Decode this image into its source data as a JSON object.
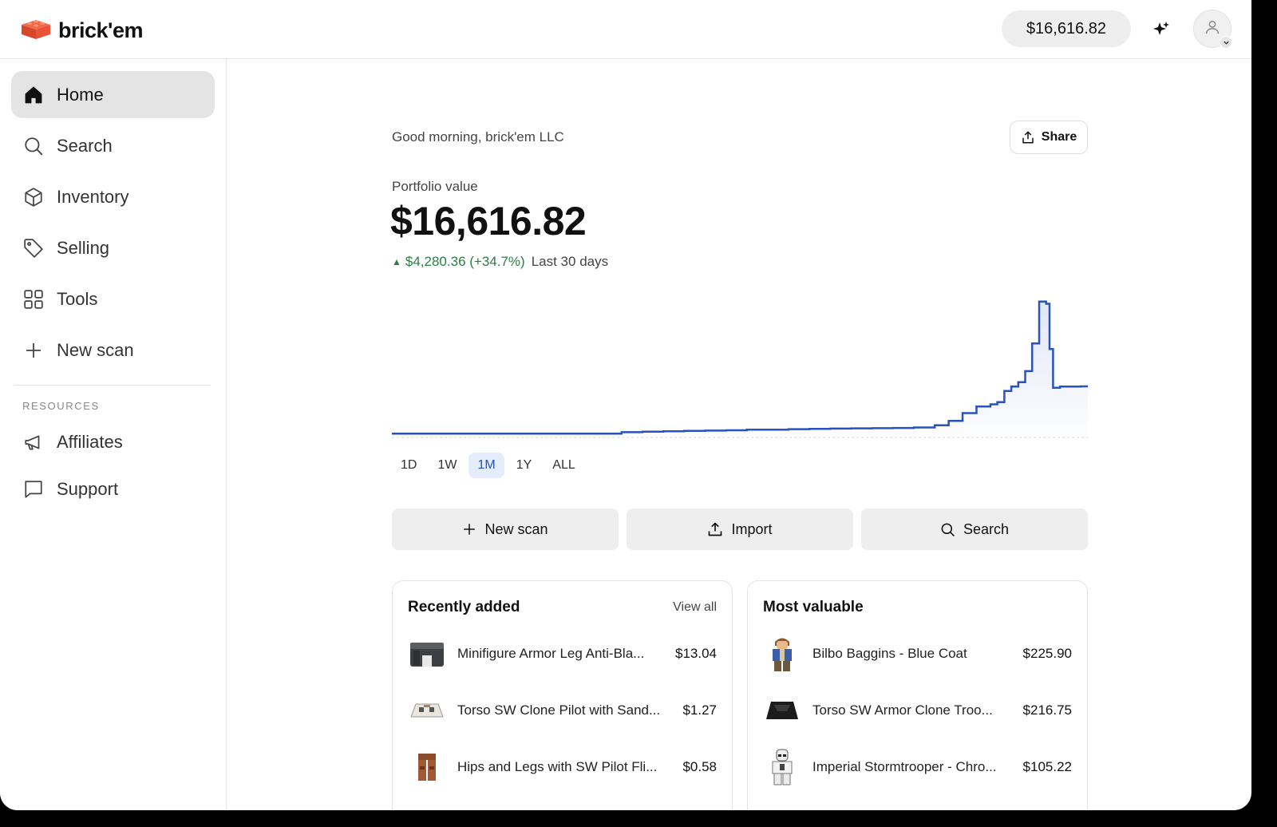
{
  "header": {
    "brand": "brick'em",
    "balance": "$16,616.82",
    "sparkle_icon": "sparkles-icon",
    "avatar_icon": "user-icon"
  },
  "sidebar": {
    "items": [
      {
        "label": "Home",
        "icon": "home-icon",
        "active": true
      },
      {
        "label": "Search",
        "icon": "search-icon"
      },
      {
        "label": "Inventory",
        "icon": "box-icon"
      },
      {
        "label": "Selling",
        "icon": "tag-icon"
      },
      {
        "label": "Tools",
        "icon": "grid-icon"
      },
      {
        "label": "New scan",
        "icon": "plus-icon"
      }
    ],
    "resources_title": "RESOURCES",
    "resources": [
      {
        "label": "Affiliates",
        "icon": "megaphone-icon"
      },
      {
        "label": "Support",
        "icon": "chat-icon"
      }
    ]
  },
  "main": {
    "greeting": "Good morning, brick'em LLC",
    "share_label": "Share",
    "portfolio_label": "Portfolio value",
    "portfolio_value": "$16,616.82",
    "change_value": "$4,280.36 (+34.7%)",
    "change_period": "Last 30 days",
    "ranges": [
      "1D",
      "1W",
      "1M",
      "1Y",
      "ALL"
    ],
    "active_range": "1M",
    "actions": [
      {
        "label": "New scan",
        "icon": "plus-icon"
      },
      {
        "label": "Import",
        "icon": "upload-icon"
      },
      {
        "label": "Search",
        "icon": "search-icon"
      }
    ]
  },
  "recently_added": {
    "title": "Recently added",
    "link": "View all",
    "items": [
      {
        "name": "Minifigure Armor Leg Anti-Bla...",
        "price": "$13.04"
      },
      {
        "name": "Torso SW Clone Pilot with Sand...",
        "price": "$1.27"
      },
      {
        "name": "Hips and Legs with SW Pilot Fli...",
        "price": "$0.58"
      }
    ]
  },
  "most_valuable": {
    "title": "Most valuable",
    "items": [
      {
        "name": "Bilbo Baggins - Blue Coat",
        "price": "$225.90"
      },
      {
        "name": "Torso SW Armor Clone Troo...",
        "price": "$216.75"
      },
      {
        "name": "Imperial Stormtrooper - Chro...",
        "price": "$105.22"
      }
    ]
  },
  "chart_data": {
    "type": "line",
    "x": [
      0,
      3,
      6,
      9,
      12,
      15,
      18,
      21,
      24,
      27,
      30,
      33,
      36,
      39,
      42,
      45,
      48,
      51,
      54,
      57,
      60,
      63,
      66,
      69,
      72,
      75,
      78,
      80,
      82,
      84,
      86,
      87,
      88,
      89,
      90,
      91,
      92,
      93,
      93.5,
      94,
      94.5,
      95,
      96,
      97,
      98,
      99,
      100
    ],
    "y": [
      12336,
      12336,
      12336,
      12345,
      12345,
      12345,
      12345,
      12345,
      12345,
      12350,
      12350,
      12480,
      12520,
      12560,
      12600,
      12620,
      12650,
      12700,
      12700,
      12750,
      12780,
      12800,
      12820,
      12840,
      12860,
      12900,
      13100,
      13500,
      14200,
      14800,
      15000,
      15200,
      16200,
      16600,
      17000,
      18000,
      20500,
      24300,
      24300,
      24100,
      20000,
      16500,
      16600,
      16600,
      16600,
      16620,
      16616.82
    ],
    "series": [
      {
        "color": "#2a52be"
      }
    ],
    "xlabel": "",
    "ylabel": "",
    "grid": false,
    "ylim": [
      12000,
      25000
    ]
  }
}
